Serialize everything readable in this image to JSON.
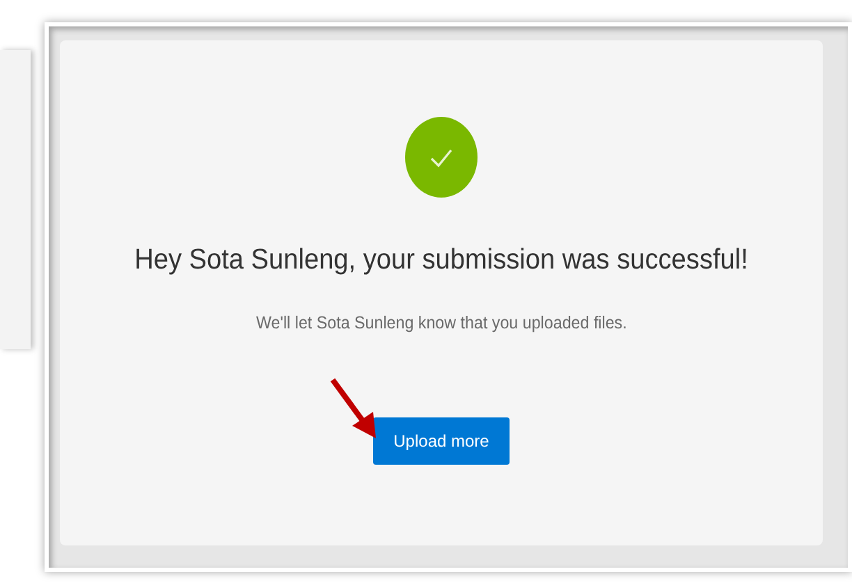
{
  "message": {
    "heading": "Hey Sota Sunleng, your submission was successful!",
    "detail": "We'll let Sota Sunleng know that you uploaded files."
  },
  "buttons": [
    {
      "label": "Upload more",
      "kind": "primary"
    }
  ]
}
